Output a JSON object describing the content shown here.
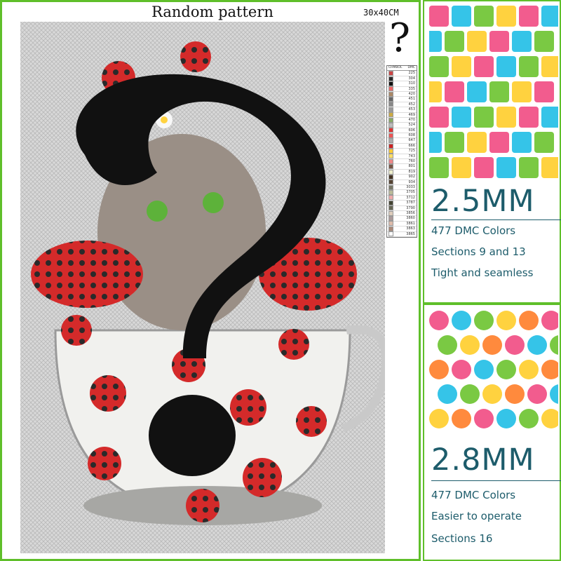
{
  "listing": {
    "title": "Random pattern",
    "size": "30x40CM",
    "mystery_mark": "?"
  },
  "legend": {
    "header_symbol": "CHMBOL",
    "header_code": "DMC",
    "codes": [
      "225",
      "304",
      "310",
      "335",
      "420",
      "451",
      "452",
      "453",
      "469",
      "470",
      "524",
      "606",
      "608",
      "647",
      "666",
      "725",
      "743",
      "760",
      "801",
      "819",
      "902",
      "934",
      "3033",
      "3705",
      "3712",
      "3787",
      "3790",
      "3856",
      "3860",
      "3861",
      "3863",
      "3865"
    ]
  },
  "offers": [
    {
      "size": "2.5MM",
      "colors": "477 DMC Colors",
      "line2": "Sections 9 and 13",
      "line3": "Tight and seamless"
    },
    {
      "size": "2.8MM",
      "colors": "477 DMC Colors",
      "line2": "Easier to operate",
      "line3": "Sections 16"
    }
  ],
  "palette": {
    "border": "#5fbf2a",
    "ladybug_red": "#d42a2a",
    "text_teal": "#1d5c6b",
    "drill_colors": [
      "#f25c8e",
      "#35c4e8",
      "#7ac943",
      "#ffd23f",
      "#ff8a3d"
    ]
  }
}
